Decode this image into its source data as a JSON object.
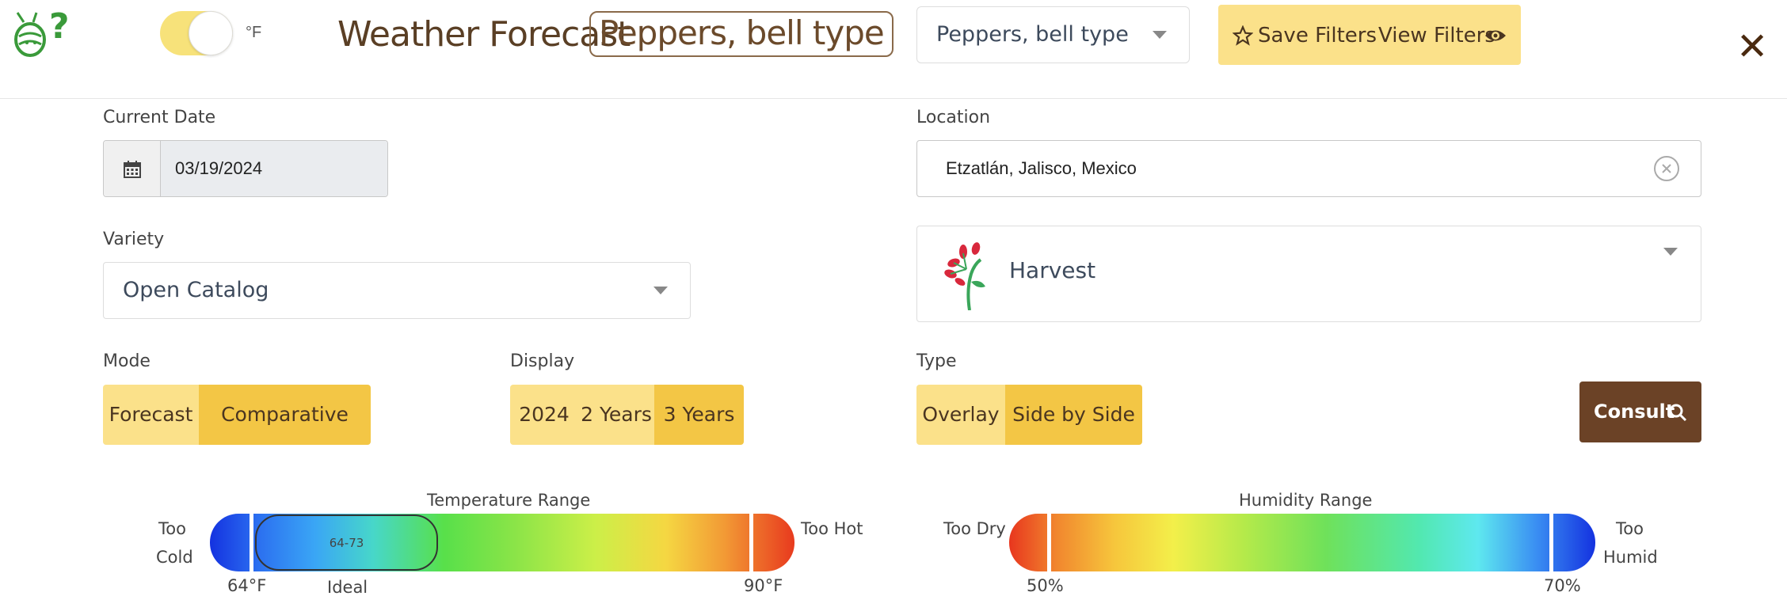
{
  "header": {
    "unit": "°F",
    "title": "Weather Forecast",
    "title_crop": "Peppers, bell type",
    "crop_select": "Peppers, bell type",
    "save_filters": "Save Filters",
    "view_filters": "View Filters",
    "close": "✕"
  },
  "form": {
    "current_date_label": "Current Date",
    "current_date": "03/19/2024",
    "location_label": "Location",
    "location": "Etzatlán, Jalisco, Mexico",
    "variety_label": "Variety",
    "variety": "Open Catalog",
    "stage": "Harvest",
    "mode_label": "Mode",
    "mode_options": [
      "Forecast",
      "Comparative"
    ],
    "mode_selected": "Comparative",
    "display_label": "Display",
    "display_options": [
      "2024",
      "2 Years",
      "3 Years"
    ],
    "display_selected": "3 Years",
    "type_label": "Type",
    "type_options": [
      "Overlay",
      "Side by Side"
    ],
    "type_selected": "Side by Side",
    "consult": "Consult"
  },
  "temperature": {
    "title": "Temperature Range",
    "too_cold": [
      "Too",
      "Cold"
    ],
    "too_hot": "Too Hot",
    "low": "64°F",
    "high": "90°F",
    "ideal_label": "Ideal",
    "ideal_range": "64-73"
  },
  "humidity": {
    "title": "Humidity Range",
    "too_dry": "Too Dry",
    "too_humid": [
      "Too",
      "Humid"
    ],
    "low": "50%",
    "high": "70%"
  },
  "colors": {
    "accent_light": "#fbe18a",
    "accent_active": "#f3c645",
    "brand_brown": "#6b4226"
  }
}
